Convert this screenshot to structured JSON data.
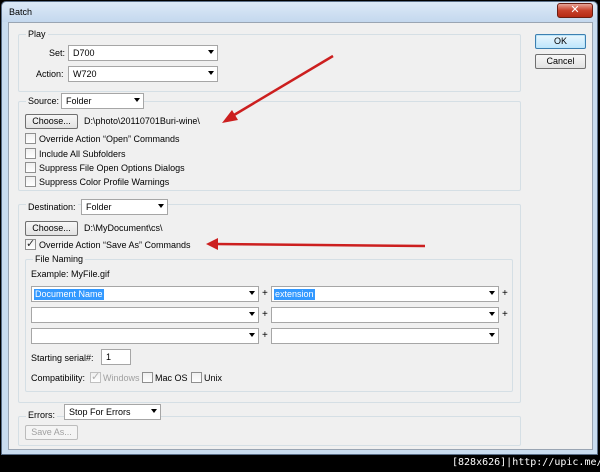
{
  "window": {
    "title": "Batch",
    "close_glyph": "✕"
  },
  "buttons": {
    "ok": "OK",
    "cancel": "Cancel"
  },
  "play": {
    "legend": "Play",
    "set_label": "Set:",
    "set_value": "D700",
    "action_label": "Action:",
    "action_value": "W720"
  },
  "source": {
    "legend_label": "Source:",
    "value": "Folder",
    "choose": "Choose...",
    "path": "D:\\photo\\20110701Buri-wine\\",
    "options": [
      {
        "label": "Override Action “Open” Commands",
        "checked": false
      },
      {
        "label": "Include All Subfolders",
        "checked": false
      },
      {
        "label": "Suppress File Open Options Dialogs",
        "checked": false
      },
      {
        "label": "Suppress Color Profile Warnings",
        "checked": false
      }
    ]
  },
  "destination": {
    "legend_label": "Destination:",
    "value": "Folder",
    "choose": "Choose...",
    "path": "D:\\MyDocument\\cs\\",
    "override_label": "Override Action “Save As” Commands",
    "override_checked": true,
    "file_naming": {
      "legend": "File Naming",
      "example": "Example: MyFile.gif",
      "fields": [
        "Document Name",
        "extension",
        "",
        "",
        "",
        ""
      ],
      "plus": "+",
      "serial_label": "Starting serial#:",
      "serial_value": "1",
      "compat_label": "Compatibility:",
      "compat": [
        {
          "label": "Windows",
          "checked": true,
          "disabled": true
        },
        {
          "label": "Mac OS",
          "checked": false,
          "disabled": false
        },
        {
          "label": "Unix",
          "checked": false,
          "disabled": false
        }
      ]
    }
  },
  "errors": {
    "label": "Errors:",
    "value": "Stop For Errors",
    "save_as": "Save As..."
  },
  "annotation": {
    "arrow_color": "#cc1f1f"
  },
  "watermark": "[828x626]|http://upic.me/"
}
